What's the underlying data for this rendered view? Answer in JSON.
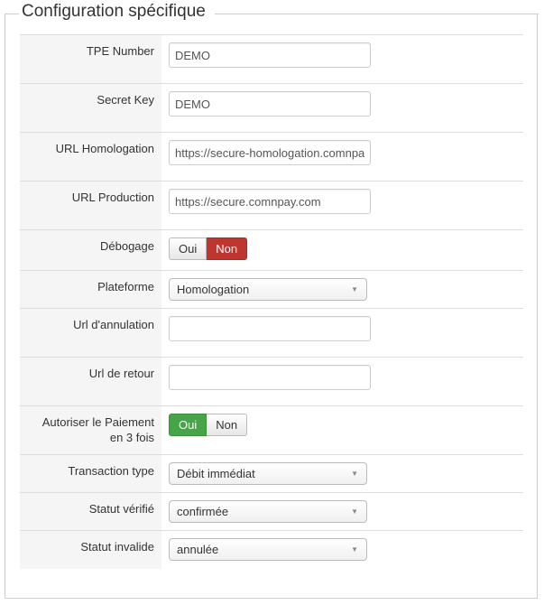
{
  "legend": "Configuration spécifique",
  "fields": {
    "tpe_number": {
      "label": "TPE Number",
      "value": "DEMO"
    },
    "secret_key": {
      "label": "Secret Key",
      "value": "DEMO"
    },
    "url_homologation": {
      "label": "URL Homologation",
      "value": "https://secure-homologation.comnpa"
    },
    "url_production": {
      "label": "URL Production",
      "value": "https://secure.comnpay.com"
    },
    "debogage": {
      "label": "Débogage",
      "options": [
        "Oui",
        "Non"
      ],
      "selected": "Non"
    },
    "plateforme": {
      "label": "Plateforme",
      "value": "Homologation"
    },
    "url_annulation": {
      "label": "Url d'annulation",
      "value": ""
    },
    "url_retour": {
      "label": "Url de retour",
      "value": ""
    },
    "paiement_3_fois": {
      "label_line1": "Autoriser le Paiement",
      "label_line2": "en 3 fois",
      "options": [
        "Oui",
        "Non"
      ],
      "selected": "Oui"
    },
    "transaction_type": {
      "label": "Transaction type",
      "value": "Débit immédiat"
    },
    "statut_verifie": {
      "label": "Statut vérifié",
      "value": "confirmée"
    },
    "statut_invalide": {
      "label": "Statut invalide",
      "value": "annulée"
    }
  },
  "icons": {
    "dropdown_arrow": "▼"
  },
  "colors": {
    "danger": "#bd362f",
    "success": "#46a546"
  }
}
